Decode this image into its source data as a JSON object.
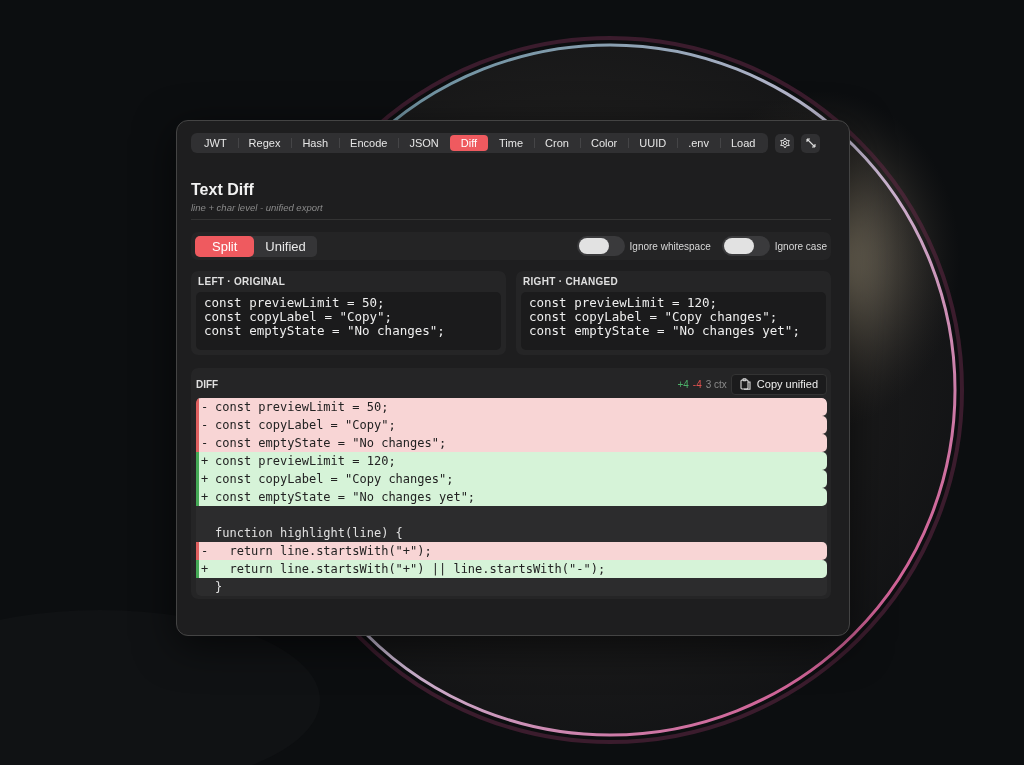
{
  "tabs": [
    {
      "label": "JWT",
      "selected": false
    },
    {
      "label": "Regex",
      "selected": false
    },
    {
      "label": "Hash",
      "selected": false
    },
    {
      "label": "Encode",
      "selected": false
    },
    {
      "label": "JSON",
      "selected": false
    },
    {
      "label": "Diff",
      "selected": true
    },
    {
      "label": "Time",
      "selected": false
    },
    {
      "label": "Cron",
      "selected": false
    },
    {
      "label": "Color",
      "selected": false
    },
    {
      "label": "UUID",
      "selected": false
    },
    {
      "label": ".env",
      "selected": false
    },
    {
      "label": "Load",
      "selected": false
    }
  ],
  "header": {
    "title": "Text Diff",
    "subtitle": "line + char level - unified export"
  },
  "view_modes": [
    {
      "label": "Split",
      "selected": true
    },
    {
      "label": "Unified",
      "selected": false
    }
  ],
  "options": [
    {
      "label": "Ignore whitespace",
      "on": false
    },
    {
      "label": "Ignore case",
      "on": false
    }
  ],
  "inputs": [
    {
      "label": "LEFT · ORIGINAL",
      "lines": [
        "const previewLimit = 50;",
        "const copyLabel = \"Copy\";",
        "const emptyState = \"No changes\";"
      ]
    },
    {
      "label": "RIGHT · CHANGED",
      "lines": [
        "const previewLimit = 120;",
        "const copyLabel = \"Copy changes\";",
        "const emptyState = \"No changes yet\";"
      ]
    }
  ],
  "diff": {
    "title": "DIFF",
    "added": "+4",
    "removed": "-4",
    "context": "3 ctx",
    "copy_button": "Copy unified",
    "lines": [
      {
        "kind": "removed",
        "sign": "-",
        "text": "const previewLimit = 50;"
      },
      {
        "kind": "removed",
        "sign": "-",
        "text": "const copyLabel = \"Copy\";"
      },
      {
        "kind": "removed",
        "sign": "-",
        "text": "const emptyState = \"No changes\";"
      },
      {
        "kind": "added",
        "sign": "+",
        "text": "const previewLimit = 120;"
      },
      {
        "kind": "added",
        "sign": "+",
        "text": "const copyLabel = \"Copy changes\";"
      },
      {
        "kind": "added",
        "sign": "+",
        "text": "const emptyState = \"No changes yet\";"
      },
      {
        "kind": "blank"
      },
      {
        "kind": "context",
        "text": "function highlight(line) {"
      },
      {
        "kind": "removed",
        "sign": "-",
        "text": "  return line.startsWith(\"+\");"
      },
      {
        "kind": "added",
        "sign": "+",
        "text": "  return line.startsWith(\"+\") || line.startsWith(\"-\");"
      },
      {
        "kind": "context",
        "text": "}"
      }
    ]
  }
}
